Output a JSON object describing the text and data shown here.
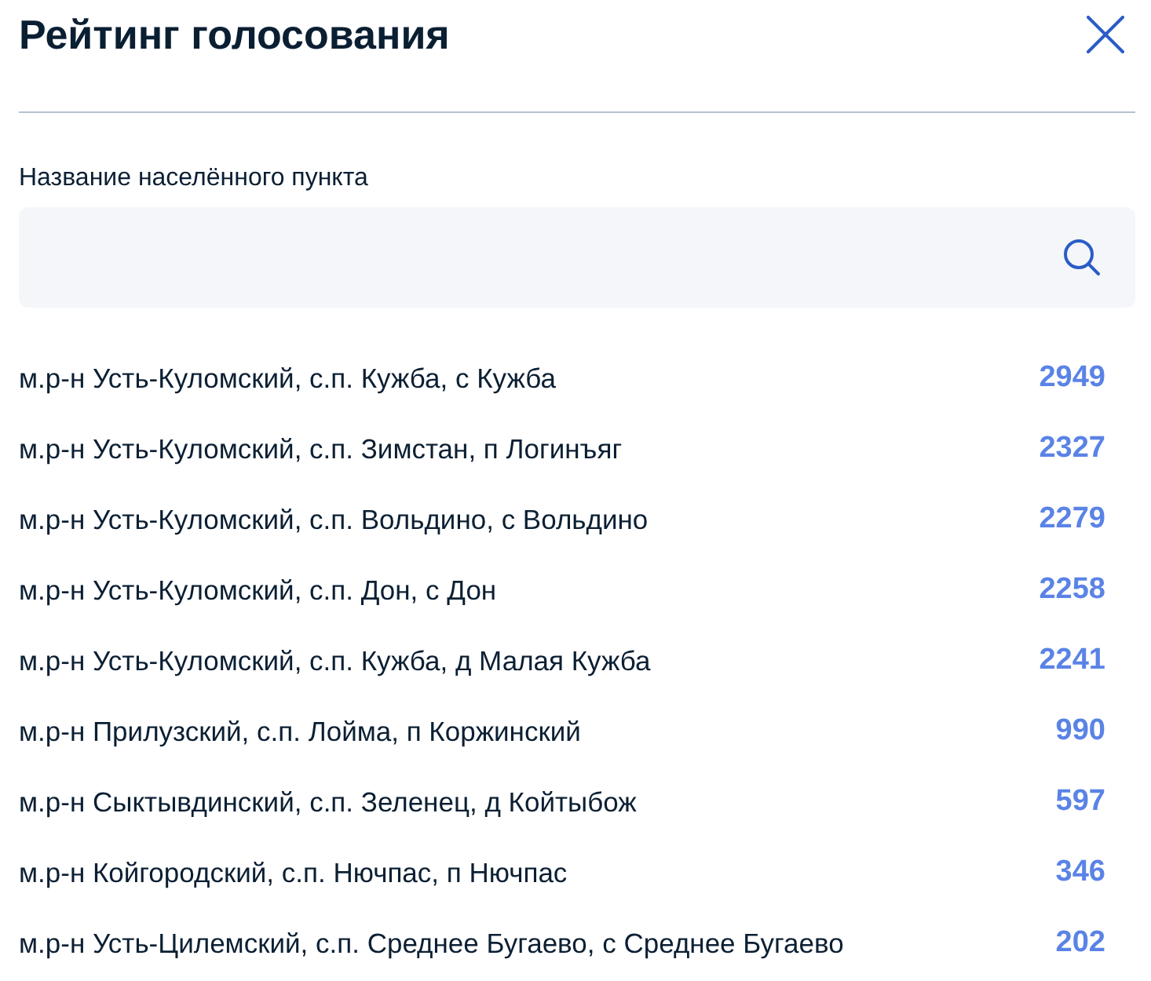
{
  "dialog": {
    "title": "Рейтинг голосования"
  },
  "search": {
    "label": "Название населённого пункта"
  },
  "rating": [
    {
      "place": "м.р-н Усть-Куломский, с.п. Кужба, с Кужба",
      "votes": "2949"
    },
    {
      "place": "м.р-н Усть-Куломский, с.п. Зимстан, п Логинъяг",
      "votes": "2327"
    },
    {
      "place": "м.р-н Усть-Куломский, с.п. Вольдино, с Вольдино",
      "votes": "2279"
    },
    {
      "place": "м.р-н Усть-Куломский, с.п. Дон, с Дон",
      "votes": "2258"
    },
    {
      "place": "м.р-н Усть-Куломский, с.п. Кужба, д Малая Кужба",
      "votes": "2241"
    },
    {
      "place": "м.р-н Прилузский, с.п. Лойма, п Коржинский",
      "votes": "990"
    },
    {
      "place": "м.р-н Сыктывдинский, с.п. Зеленец, д Койтыбож",
      "votes": "597"
    },
    {
      "place": "м.р-н Койгородский, с.п. Нючпас, п Нючпас",
      "votes": "346"
    },
    {
      "place": "м.р-н Усть-Цилемский, с.п. Среднее Бугаево, с Среднее Бугаево",
      "votes": "202"
    }
  ]
}
